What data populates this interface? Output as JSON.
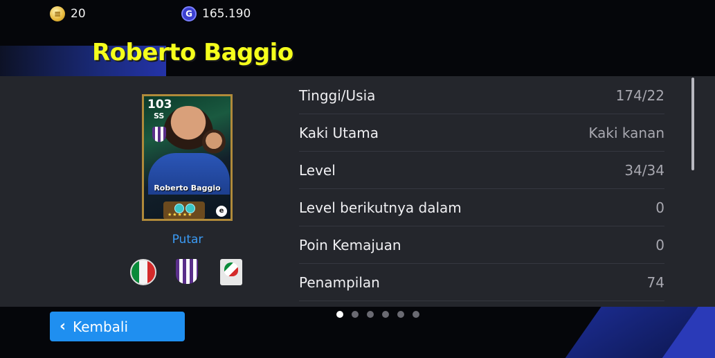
{
  "currency": {
    "efootball_coins": "20",
    "gp": "165.190",
    "coin_icon": "efootball-coin-icon",
    "gp_icon": "gp-icon"
  },
  "player": {
    "name": "Roberto Baggio"
  },
  "card": {
    "rating": "103",
    "position": "SS",
    "name": "Roberto Baggio",
    "stars": "★★★★★",
    "logo": "e"
  },
  "putar_label": "Putar",
  "badges": [
    "italy-flag-icon",
    "club-crest-icon",
    "league-logo-icon"
  ],
  "stats": [
    {
      "label": "Tinggi/Usia",
      "value": "174/22"
    },
    {
      "label": "Kaki Utama",
      "value": "Kaki kanan"
    },
    {
      "label": "Level",
      "value": "34/34"
    },
    {
      "label": "Level berikutnya dalam",
      "value": "0"
    },
    {
      "label": "Poin Kemajuan",
      "value": "0"
    },
    {
      "label": "Penampilan",
      "value": "74"
    }
  ],
  "pagination": {
    "total": 6,
    "active": 1
  },
  "back_button": {
    "label": "Kembali"
  },
  "colors": {
    "name_yellow": "#f5ff1c",
    "accent_blue": "#1f8ff0",
    "link_blue": "#3b9bf5",
    "panel": "#24262c"
  }
}
